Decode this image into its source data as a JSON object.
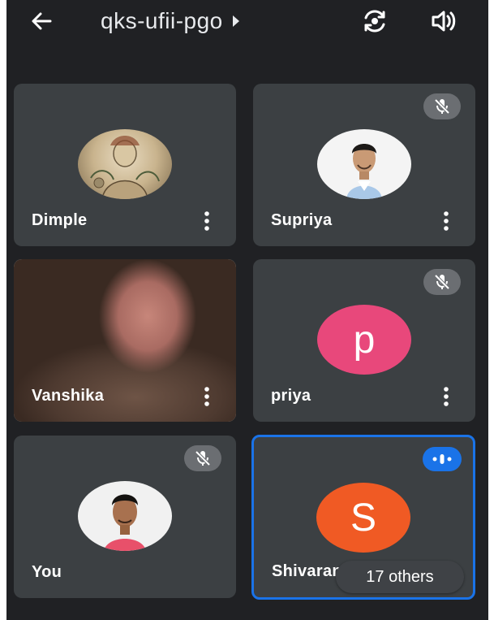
{
  "meeting": {
    "code": "qks-ufii-pgo",
    "icons": {
      "back": "arrow-back-icon",
      "title_caret": "caret-right-icon",
      "switch_camera": "switch-camera-icon",
      "audio": "speaker-icon"
    }
  },
  "participants": [
    {
      "name": "Dimple",
      "avatar": "photo",
      "muted": false
    },
    {
      "name": "Supriya",
      "avatar": "photo",
      "muted": true
    },
    {
      "name": "Vanshika",
      "avatar": "video",
      "muted": false
    },
    {
      "name": "priya",
      "avatar": "letter",
      "letter": "p",
      "avatar_color": "#e8487b",
      "muted": true
    },
    {
      "name": "You",
      "avatar": "photo",
      "muted": true
    },
    {
      "name": "Shivaram",
      "avatar": "letter",
      "letter": "S",
      "avatar_color": "#f05a24",
      "speaking": true
    }
  ],
  "others_label": "17 others",
  "colors": {
    "background": "#202124",
    "tile": "#3c4043",
    "active_border": "#1a73e8"
  }
}
